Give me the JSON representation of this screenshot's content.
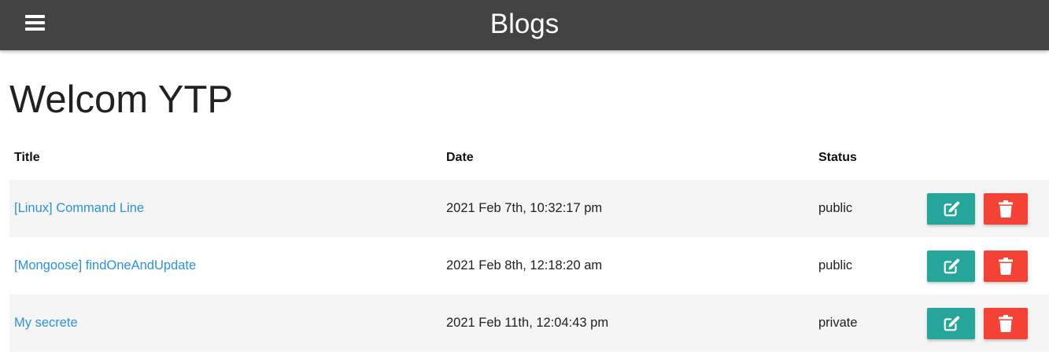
{
  "navbar": {
    "brand": "Blogs",
    "menu_icon": "hamburger-menu-icon",
    "background": "#424242"
  },
  "page": {
    "title": "Welcom YTP"
  },
  "table": {
    "headers": [
      "Title",
      "Date",
      "Status",
      ""
    ],
    "rows": [
      {
        "title": "[Linux] Command Line",
        "date": "2021 Feb 7th, 10:32:17 pm",
        "status": "public"
      },
      {
        "title": "[Mongoose] findOneAndUpdate",
        "date": "2021 Feb 8th, 12:18:20 am",
        "status": "public"
      },
      {
        "title": "My secrete",
        "date": "2021 Feb 11th, 12:04:43 pm",
        "status": "private"
      }
    ],
    "actions": {
      "edit_icon": "edit-icon",
      "delete_icon": "trash-icon",
      "edit_color": "#26a69a",
      "delete_color": "#f44336"
    }
  },
  "colors": {
    "link": "#2a93d5",
    "striped_row": "#f5f5f5"
  }
}
